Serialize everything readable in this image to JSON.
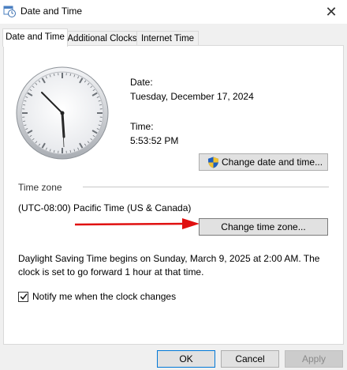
{
  "window": {
    "title": "Date and Time",
    "close_glyph": "✕"
  },
  "tabs": [
    {
      "label": "Date and Time",
      "active": true
    },
    {
      "label": "Additional Clocks",
      "active": false
    },
    {
      "label": "Internet Time",
      "active": false
    }
  ],
  "date": {
    "label": "Date:",
    "value": "Tuesday, December 17, 2024"
  },
  "time": {
    "label": "Time:",
    "value": "5:53:52 PM"
  },
  "buttons": {
    "change_date_time": "Change date and time...",
    "change_time_zone": "Change time zone...",
    "ok": "OK",
    "cancel": "Cancel",
    "apply": "Apply"
  },
  "timezone": {
    "section_label": "Time zone",
    "value": "(UTC-08:00) Pacific Time (US & Canada)"
  },
  "dst": {
    "line1": "Daylight Saving Time begins on Sunday, March 9, 2025 at 2:00 AM. The",
    "line2": "clock is set to go forward 1 hour at that time."
  },
  "notify": {
    "label": "Notify me when the clock changes",
    "checked": true
  },
  "icons": {
    "window_icon": "calendar-clock-icon",
    "shield": "uac-shield-icon",
    "arrow": "red-arrow-annotation"
  },
  "colors": {
    "accent_arrow": "#e01010",
    "shield_blue": "#1f5fbf",
    "shield_yellow": "#f2c230"
  }
}
